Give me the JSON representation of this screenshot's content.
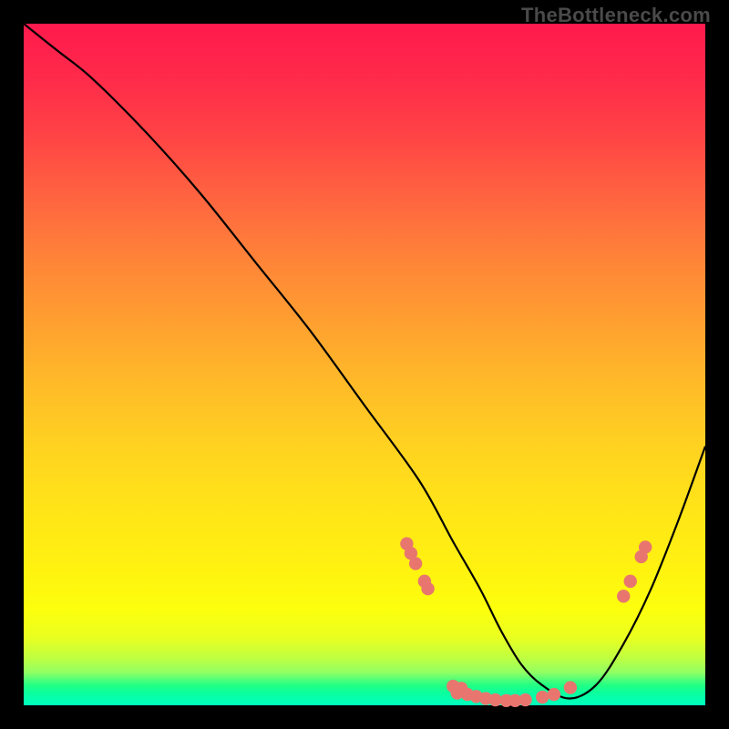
{
  "watermark": "TheBottleneck.com",
  "chart_data": {
    "type": "line",
    "title": "",
    "xlabel": "",
    "ylabel": "",
    "xlim": [
      0,
      100
    ],
    "ylim": [
      0,
      100
    ],
    "series": [
      {
        "name": "curve",
        "x": [
          0,
          5,
          10,
          18,
          26,
          34,
          42,
          50,
          58,
          63,
          67,
          70,
          73,
          76,
          80,
          84,
          88,
          92,
          96,
          100
        ],
        "y": [
          100,
          96,
          92,
          84,
          75,
          65,
          55,
          44,
          33,
          24,
          17,
          11,
          6,
          3,
          1,
          3,
          9,
          17,
          27,
          38
        ]
      }
    ],
    "points": [
      {
        "x": 56.2,
        "y": 23.7
      },
      {
        "x": 56.8,
        "y": 22.3
      },
      {
        "x": 57.5,
        "y": 20.8
      },
      {
        "x": 58.8,
        "y": 18.2
      },
      {
        "x": 59.3,
        "y": 17.1
      },
      {
        "x": 63.0,
        "y": 2.8
      },
      {
        "x": 63.6,
        "y": 1.8
      },
      {
        "x": 64.2,
        "y": 2.5
      },
      {
        "x": 65.1,
        "y": 1.6
      },
      {
        "x": 66.4,
        "y": 1.3
      },
      {
        "x": 67.8,
        "y": 1.0
      },
      {
        "x": 69.2,
        "y": 0.8
      },
      {
        "x": 70.8,
        "y": 0.7
      },
      {
        "x": 72.1,
        "y": 0.7
      },
      {
        "x": 73.6,
        "y": 0.8
      },
      {
        "x": 76.1,
        "y": 1.2
      },
      {
        "x": 77.8,
        "y": 1.6
      },
      {
        "x": 80.2,
        "y": 2.6
      },
      {
        "x": 88.0,
        "y": 16.0
      },
      {
        "x": 89.0,
        "y": 18.2
      },
      {
        "x": 90.6,
        "y": 21.8
      },
      {
        "x": 91.2,
        "y": 23.2
      }
    ],
    "gradient_stops": [
      {
        "pos": 0,
        "color": "#ff1a4d"
      },
      {
        "pos": 50,
        "color": "#ffc020"
      },
      {
        "pos": 90,
        "color": "#f0ff10"
      },
      {
        "pos": 100,
        "color": "#00ffc0"
      }
    ]
  }
}
